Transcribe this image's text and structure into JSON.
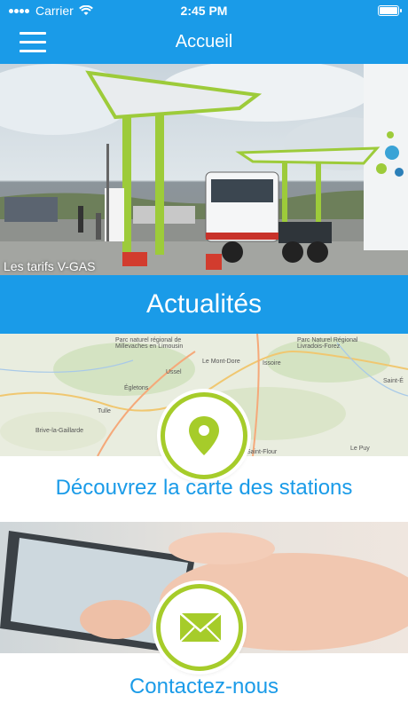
{
  "status_bar": {
    "carrier": "Carrier",
    "time": "2:45 PM"
  },
  "nav": {
    "title": "Accueil"
  },
  "hero": {
    "caption": "Les tarifs V-GAS"
  },
  "section": {
    "title": "Actualités"
  },
  "map_card": {
    "label": "Découvrez la carte des stations",
    "place_names": [
      "Parc naturel régional de Millevaches en Limousin",
      "Ussel",
      "Le Mont-Dore",
      "Issoire",
      "Parc Naturel Régional Livradois-Forez",
      "Tulle",
      "Brive-la-Gaillarde",
      "Égletons",
      "Saint-Flour",
      "Le Puy",
      "Saint-É"
    ]
  },
  "contact_card": {
    "label": "Contactez-nous"
  },
  "colors": {
    "primary": "#1a9be8",
    "accent_green": "#a6cc2a"
  }
}
